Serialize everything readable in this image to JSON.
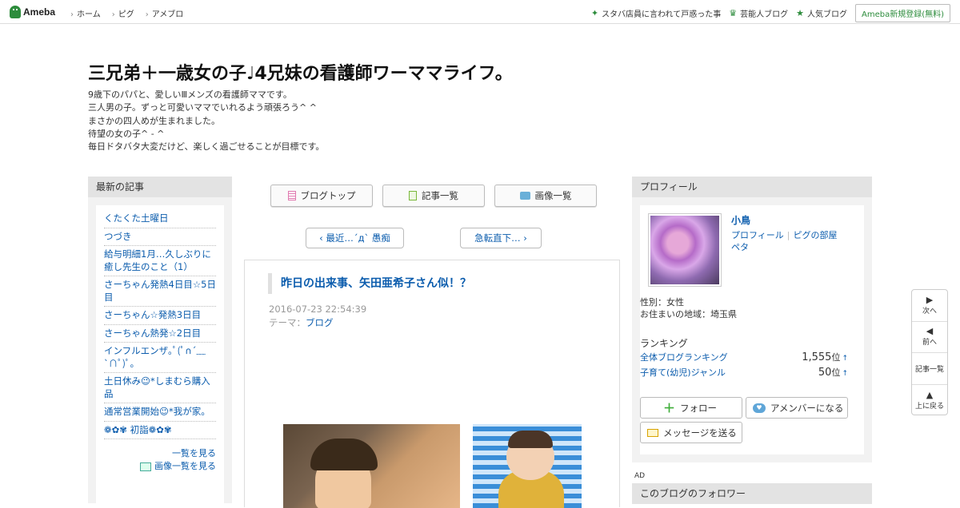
{
  "topbar": {
    "logo_text": "Ameba",
    "nav": [
      "ホーム",
      "ピグ",
      "アメブロ"
    ],
    "right_links": [
      {
        "icon": "sparkle-icon",
        "label": "スタバ店員に言われて戸惑った事"
      },
      {
        "icon": "crown-icon",
        "label": "芸能人ブログ"
      },
      {
        "icon": "star-icon",
        "label": "人気ブログ"
      }
    ],
    "register_label": "Ameba新規登録(無料)"
  },
  "blog": {
    "title": "三兄弟＋一歳女の子♩4兄妹の看護師ワーママライフ。",
    "description": [
      "9歳下のパパと、愛しいⅢメンズの看護師ママです。",
      "三人男の子。ずっと可愛いママでいれるよう頑張ろう^ ^",
      "まさかの四人めが生まれました。",
      "待望の女の子^ - ^",
      "毎日ドタバタ大変だけど、楽しく過ごせることが目標です。"
    ]
  },
  "recent": {
    "heading": "最新の記事",
    "items": [
      "くたくた土曜日",
      "つづき",
      "給与明細1月…久しぶりに癒し先生のこと（1）",
      "さーちゃん発熱4日目☆5日目",
      "さーちゃん☆発熱3日目",
      "さーちゃん熱発☆2日目",
      "インフルエンザ｡ﾟ(ﾟ∩´﹏`∩ﾟ)ﾟ｡",
      "土日休み😉*しまむら購入品",
      "通常営業開始😉*我が家。",
      "❁✿✾ 初詣❁✿✾"
    ],
    "see_all": "一覧を見る",
    "see_images": "画像一覧を見る"
  },
  "center": {
    "buttons": [
      "ブログトップ",
      "記事一覧",
      "画像一覧"
    ],
    "prev_label": "最近…´д` 愚痴",
    "next_label": "急転直下…",
    "article": {
      "title": "昨日の出来事、矢田亜希子さん似！？",
      "date": "2016-07-23 22:54:39",
      "theme_prefix": "テーマ：",
      "theme": "ブログ"
    }
  },
  "profile": {
    "heading": "プロフィール",
    "name": "小鳥",
    "link1": "プロフィール",
    "link2": "ピグの部屋",
    "link3": "ペタ",
    "gender": "性別：女性",
    "region": "お住まいの地域：埼玉県",
    "ranking_heading": "ランキング",
    "rankings": [
      {
        "label": "全体ブログランキング",
        "value": "1,555",
        "unit": "位"
      },
      {
        "label": "子育て(幼児)ジャンル",
        "value": "50",
        "unit": "位"
      }
    ],
    "follow_label": "フォロー",
    "amember_label": "アメンバーになる",
    "message_label": "メッセージを送る"
  },
  "ad_label": "AD",
  "followers_heading": "このブログのフォロワー",
  "sidenav": {
    "next": "次へ",
    "prev": "前へ",
    "list": "記事一覧",
    "top": "上に戻る"
  }
}
